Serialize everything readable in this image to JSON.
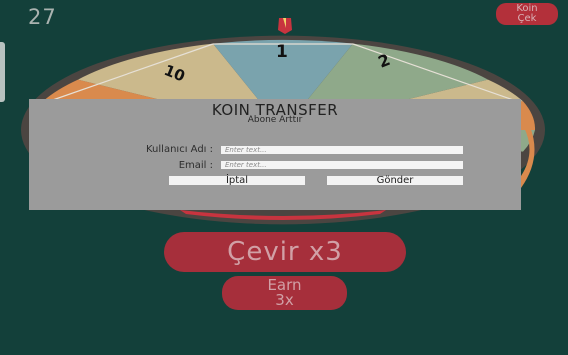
{
  "hud": {
    "coins": "27",
    "koin_cek_line1": "Koin",
    "koin_cek_line2": "Çek"
  },
  "wheel": {
    "segment_labels": [
      "10",
      "1",
      "2"
    ],
    "colors": {
      "outer_ring": "#4b4541",
      "segment_tan": "#cbb98c",
      "segment_blue": "#7aa3ad",
      "segment_green": "#8fa98a",
      "segment_orange": "#d98a4d",
      "pointer": "#c8343f"
    }
  },
  "dialog": {
    "title": "KOIN TRANSFER",
    "subtitle": "Abone Arttır",
    "username_label": "Kullanıcı Adı :",
    "username_placeholder": "Enter text...",
    "username_value": "",
    "email_label": "Email :",
    "email_placeholder": "Enter text...",
    "email_value": "",
    "cancel_label": "İptal",
    "send_label": "Gönder"
  },
  "actions": {
    "spin_label": "Çevir x3",
    "earn_line1": "Earn",
    "earn_line2": "3x"
  },
  "colors": {
    "background": "#13403a",
    "accent_red": "#a62f3b",
    "dialog_bg": "#9b9b9b"
  }
}
